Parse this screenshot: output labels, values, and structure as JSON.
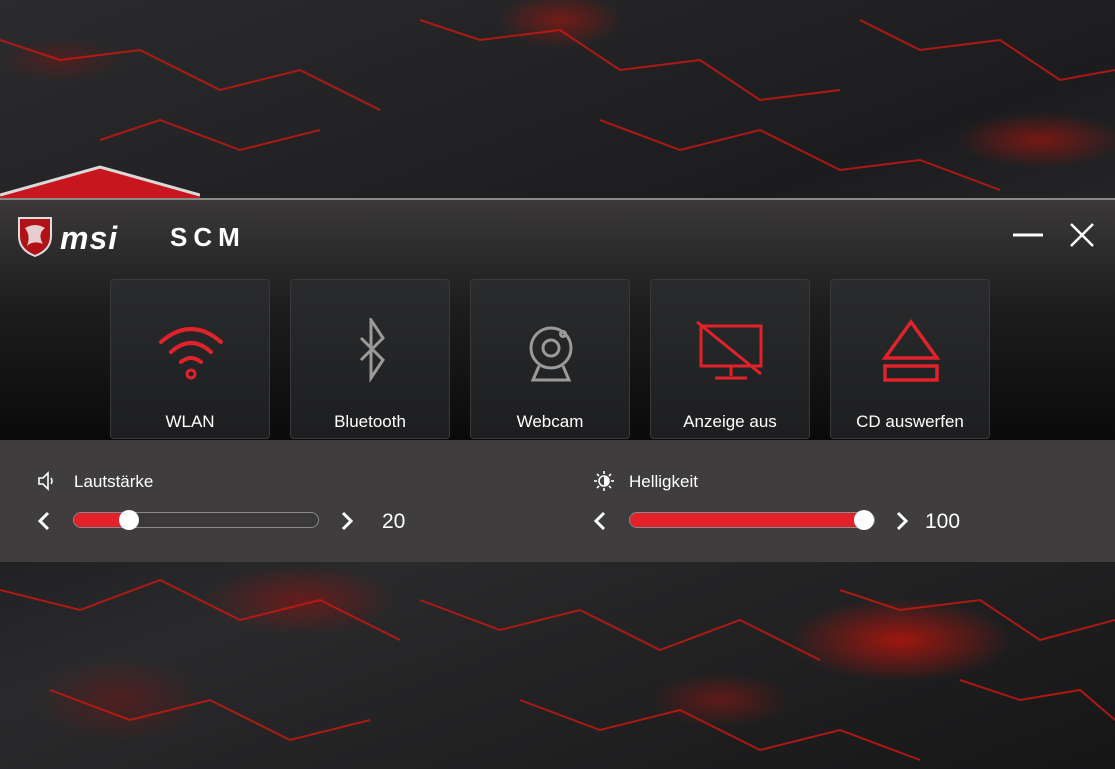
{
  "app": {
    "brand": "msi",
    "product": "SCM"
  },
  "window_controls": [
    {
      "name": "minimize-icon"
    },
    {
      "name": "close-icon"
    }
  ],
  "tiles": [
    {
      "label": "WLAN",
      "icon": "wifi-icon",
      "active": true
    },
    {
      "label": "Bluetooth",
      "icon": "bluetooth-icon",
      "active": false
    },
    {
      "label": "Webcam",
      "icon": "webcam-icon",
      "active": false
    },
    {
      "label": "Anzeige aus",
      "icon": "display-off-icon",
      "active": true
    },
    {
      "label": "CD auswerfen",
      "icon": "eject-icon",
      "active": true
    }
  ],
  "volume": {
    "label": "Lautstärke",
    "icon": "speaker-icon",
    "value": 20,
    "value_text": "20",
    "fraction": 0.2
  },
  "brightness": {
    "label": "Helligkeit",
    "icon": "brightness-icon",
    "value": 100,
    "value_text": "100",
    "fraction": 1.0
  },
  "colors": {
    "accent": "#e1222b",
    "tile_bg": "#1d1e20",
    "panel_bg": "#3f3d3d",
    "icon_inactive": "#9a9a9a"
  }
}
